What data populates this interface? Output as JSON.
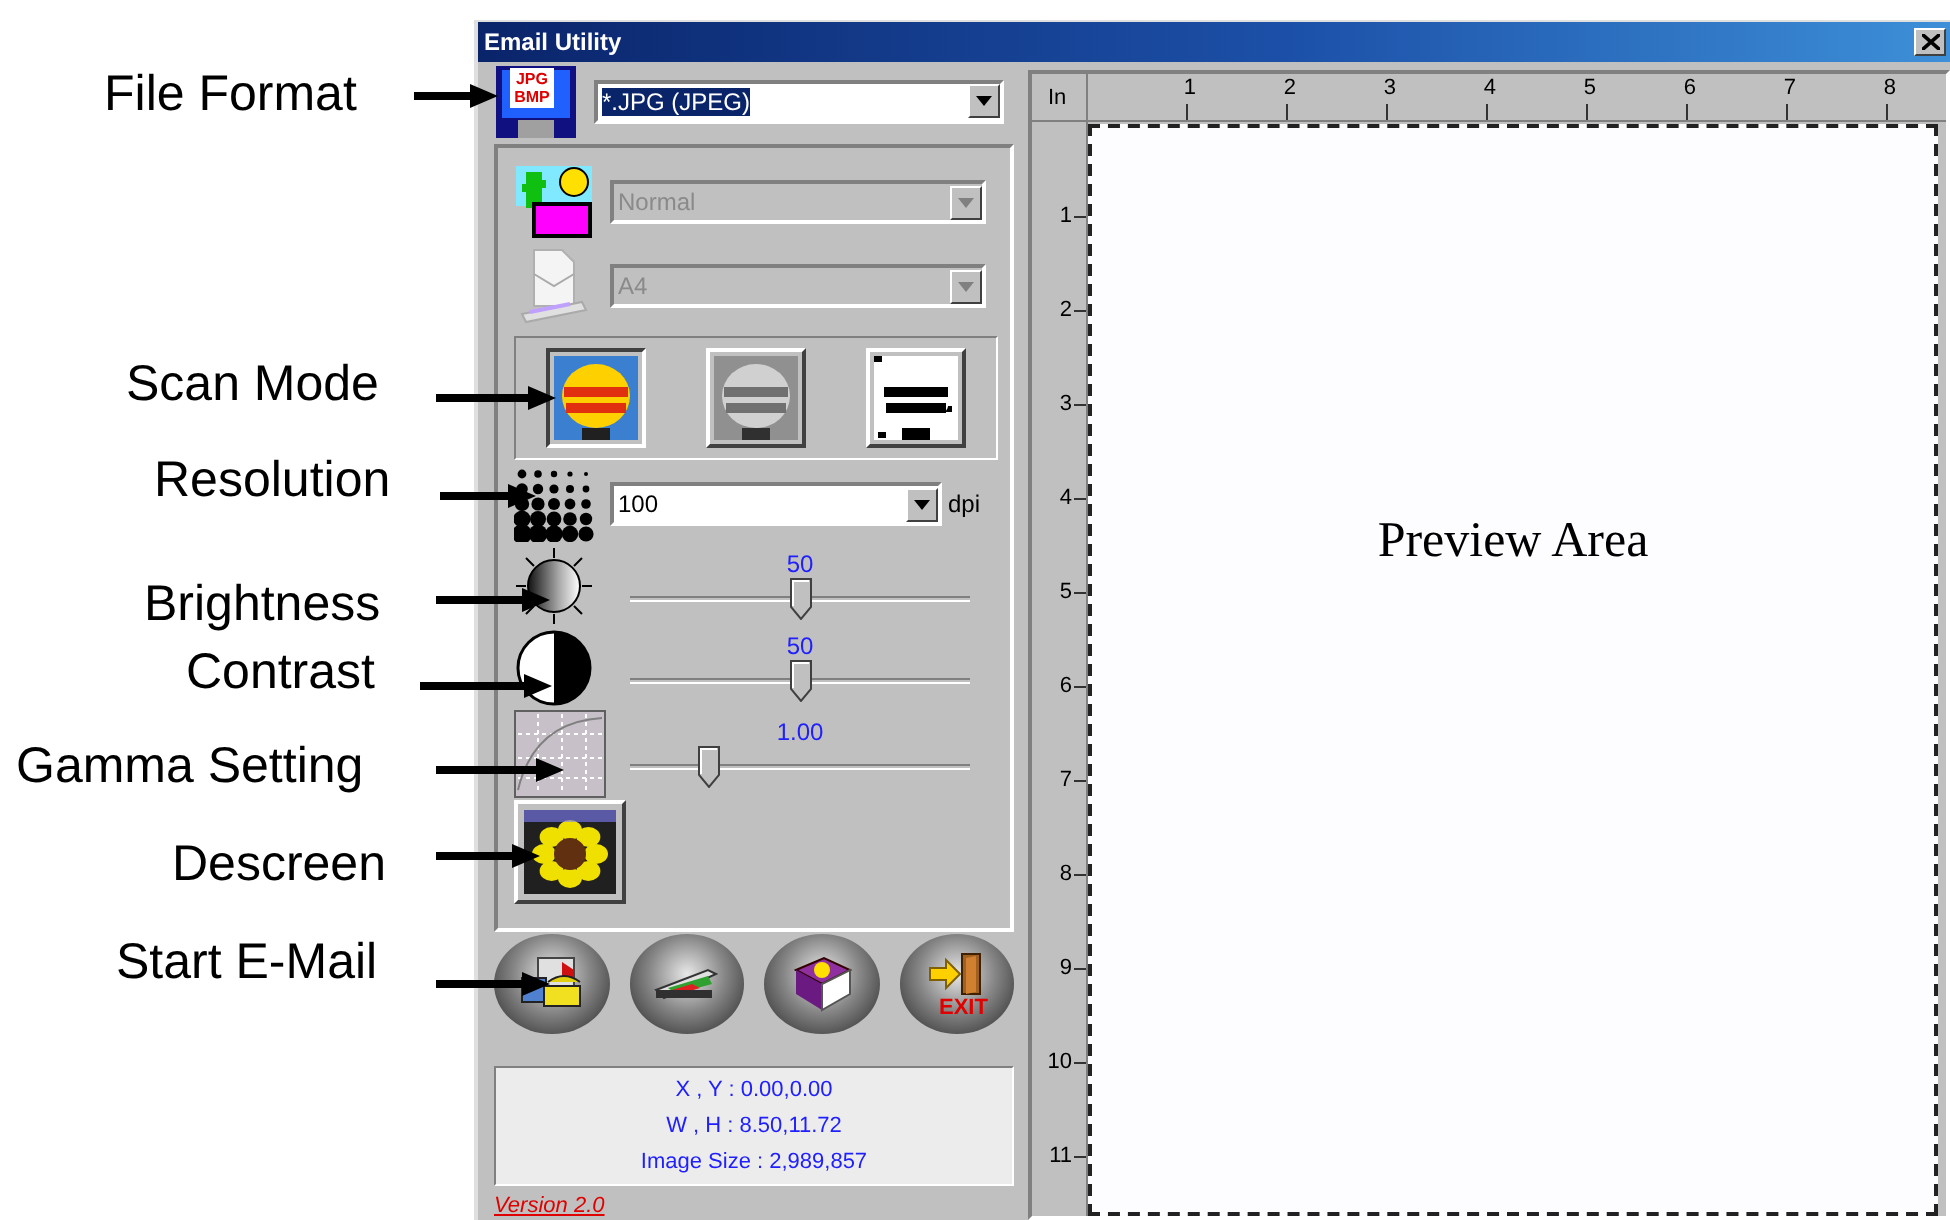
{
  "callouts": [
    {
      "label": "File Format"
    },
    {
      "label": "Scan Mode"
    },
    {
      "label": "Resolution"
    },
    {
      "label": "Brightness"
    },
    {
      "label": "Contrast"
    },
    {
      "label": "Gamma Setting"
    },
    {
      "label": "Descreen"
    },
    {
      "label": "Start E-Mail"
    }
  ],
  "window": {
    "title": "Email Utility"
  },
  "file_format": {
    "icon_text": [
      "JPG",
      "BMP"
    ],
    "value": "*.JPG (JPEG)",
    "highlighted": true
  },
  "image_type": {
    "value": "Normal",
    "disabled": true
  },
  "paper_size": {
    "value": "A4",
    "disabled": true
  },
  "scan_modes": [
    {
      "kind": "color",
      "selected": true
    },
    {
      "kind": "gray",
      "selected": false
    },
    {
      "kind": "lineart",
      "selected": false
    }
  ],
  "resolution": {
    "value": "100",
    "unit": "dpi"
  },
  "sliders": [
    {
      "kind": "brightness",
      "reading": "50",
      "level": 0.5
    },
    {
      "kind": "contrast",
      "reading": "50",
      "level": 0.5
    },
    {
      "kind": "gamma",
      "reading": "1.00",
      "level": 0.23
    }
  ],
  "action_buttons": [
    {
      "kind": "email"
    },
    {
      "kind": "scan"
    },
    {
      "kind": "help"
    },
    {
      "kind": "exit",
      "label": "EXIT"
    }
  ],
  "info": [
    "X , Y : 0.00,0.00",
    "W , H : 8.50,11.72",
    "Image Size : 2,989,857"
  ],
  "version": "Version 2.0",
  "preview": {
    "unit": "In",
    "x_ruler": [
      "1",
      "2",
      "3",
      "4",
      "5",
      "6",
      "7",
      "8"
    ],
    "y_ruler": [
      "1",
      "2",
      "3",
      "4",
      "5",
      "6",
      "7",
      "8",
      "9",
      "10",
      "11"
    ],
    "label": "Preview Area"
  }
}
